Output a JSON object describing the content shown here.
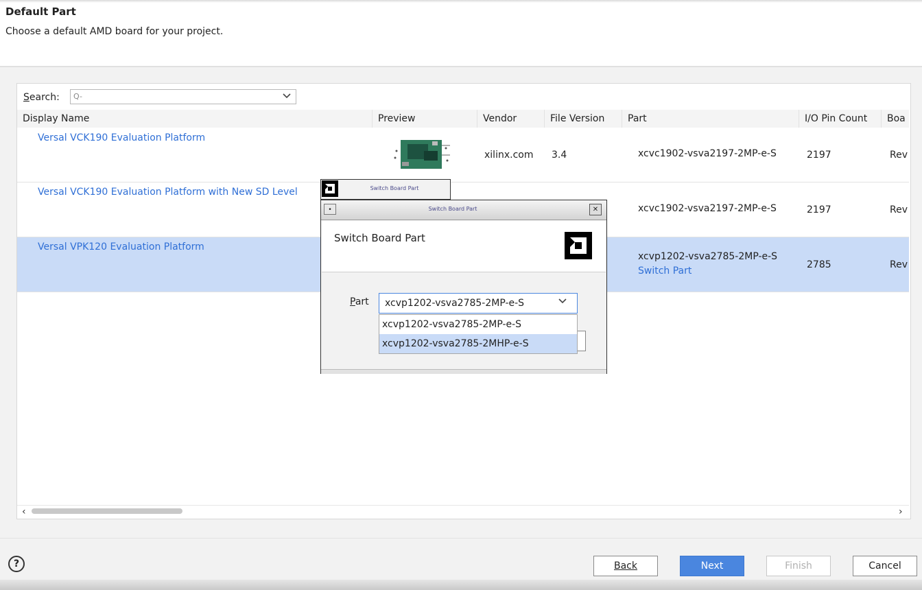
{
  "header": {
    "title": "Default Part",
    "subtitle": "Choose a default AMD board for your project."
  },
  "search": {
    "label": "Search:",
    "placeholder": "Q-"
  },
  "table": {
    "columns": [
      "Display Name",
      "Preview",
      "Vendor",
      "File Version",
      "Part",
      "I/O Pin Count",
      "Boa"
    ],
    "rows": [
      {
        "display_name": "Versal VCK190 Evaluation Platform",
        "vendor": "xilinx.com",
        "file_version": "3.4",
        "part": "xcvc1902-vsva2197-2MP-e-S",
        "io_pin_count": "2197",
        "board_rev": "Rev"
      },
      {
        "display_name": "Versal VCK190 Evaluation Platform with New SD Level",
        "vendor": "",
        "file_version": "",
        "part": "xcvc1902-vsva2197-2MP-e-S",
        "io_pin_count": "2197",
        "board_rev": "Rev"
      },
      {
        "display_name": "Versal VPK120 Evaluation Platform",
        "vendor": "",
        "file_version": "",
        "part": "xcvp1202-vsva2785-2MP-e-S",
        "switch_part_link": "Switch Part",
        "io_pin_count": "2785",
        "board_rev": "Rev",
        "selected": true
      }
    ]
  },
  "dialog": {
    "back_window_title": "Switch Board Part",
    "window_title": "Switch Board Part",
    "heading": "Switch Board Part",
    "part_label": "Part",
    "part_value": "xcvp1202-vsva2785-2MP-e-S",
    "options": [
      "xcvp1202-vsva2785-2MP-e-S",
      "xcvp1202-vsva2785-2MHP-e-S"
    ],
    "highlighted_option_index": 1
  },
  "footer": {
    "help": "?",
    "back": "Back",
    "next": "Next",
    "finish": "Finish",
    "cancel": "Cancel"
  },
  "icons": {
    "search": "search-icon",
    "dropdown": "chevron-down-icon",
    "help": "help-icon",
    "amd_logo": "amd-logo-icon",
    "close": "close-icon"
  },
  "colors": {
    "link": "#2f6fd6",
    "selection": "#c9dbf7",
    "primary_button": "#4a86df"
  }
}
